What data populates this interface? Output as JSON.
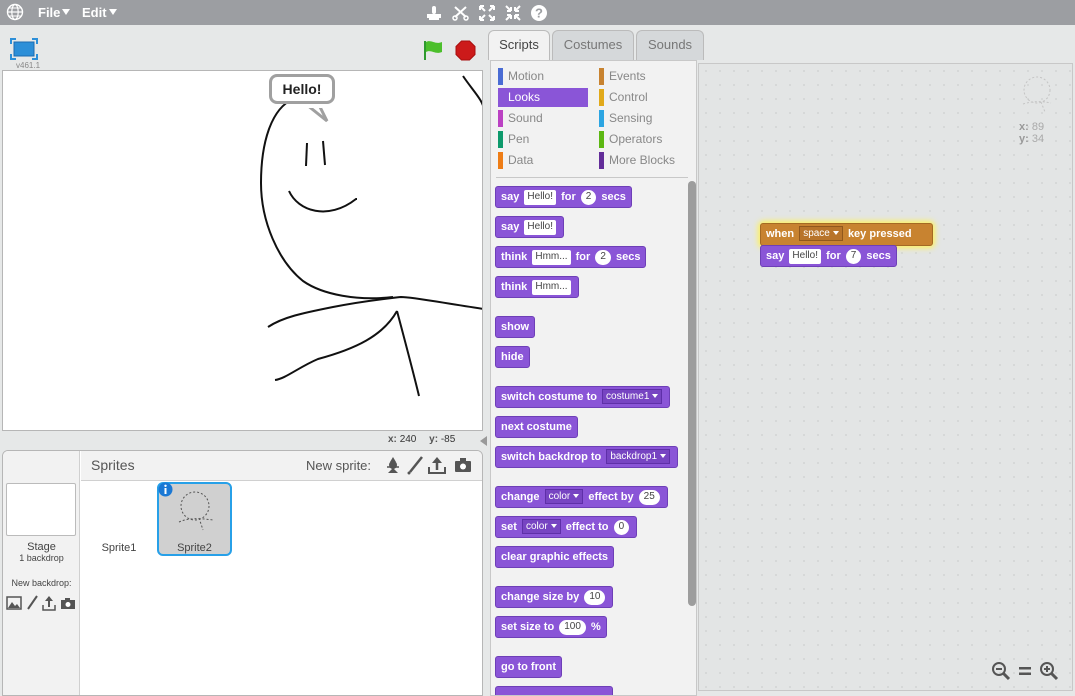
{
  "menu": {
    "file": "File",
    "edit": "Edit"
  },
  "stage": {
    "version": "v461.1",
    "speech": "Hello!",
    "x_label": "x:",
    "x_value": "240",
    "y_label": "y:",
    "y_value": "-85"
  },
  "sprites_panel": {
    "title": "Sprites",
    "new_sprite_label": "New sprite:",
    "stage_label": "Stage",
    "stage_backdrops": "1 backdrop",
    "new_backdrop_label": "New backdrop:",
    "sprites": [
      {
        "name": "Sprite1"
      },
      {
        "name": "Sprite2"
      }
    ]
  },
  "tabs": [
    "Scripts",
    "Costumes",
    "Sounds"
  ],
  "categories": {
    "motion": "Motion",
    "looks": "Looks",
    "sound": "Sound",
    "pen": "Pen",
    "data": "Data",
    "events": "Events",
    "control": "Control",
    "sensing": "Sensing",
    "operators": "Operators",
    "more": "More Blocks"
  },
  "category_colors": {
    "motion": "#4a6cd4",
    "looks": "#8a55d7",
    "sound": "#bb42c3",
    "pen": "#0e9a6c",
    "data": "#ee7d16",
    "events": "#c88330",
    "control": "#e1a91a",
    "sensing": "#2ca5e2",
    "operators": "#5cb712",
    "more": "#632d99"
  },
  "blocks": {
    "say_for": {
      "a": "say",
      "slot": "Hello!",
      "b": "for",
      "num": "2",
      "c": "secs"
    },
    "say": {
      "a": "say",
      "slot": "Hello!"
    },
    "think_for": {
      "a": "think",
      "slot": "Hmm...",
      "b": "for",
      "num": "2",
      "c": "secs"
    },
    "think": {
      "a": "think",
      "slot": "Hmm..."
    },
    "show": "show",
    "hide": "hide",
    "switch_costume": {
      "a": "switch costume to",
      "drop": "costume1"
    },
    "next_costume": "next costume",
    "switch_backdrop": {
      "a": "switch backdrop to",
      "drop": "backdrop1"
    },
    "change_effect": {
      "a": "change",
      "drop": "color",
      "b": "effect by",
      "num": "25"
    },
    "set_effect": {
      "a": "set",
      "drop": "color",
      "b": "effect to",
      "num": "0"
    },
    "clear_effects": "clear graphic effects",
    "change_size": {
      "a": "change size by",
      "num": "10"
    },
    "set_size": {
      "a": "set size to",
      "num": "100",
      "b": "%"
    },
    "go_front": "go to front"
  },
  "script": {
    "hat": {
      "a": "when",
      "drop": "space",
      "b": "key pressed"
    },
    "say": {
      "a": "say",
      "slot": "Hello!",
      "b": "for",
      "num": "7",
      "c": "secs"
    }
  },
  "sprite_info": {
    "x_label": "x:",
    "x_value": "89",
    "y_label": "y:",
    "y_value": "34"
  }
}
